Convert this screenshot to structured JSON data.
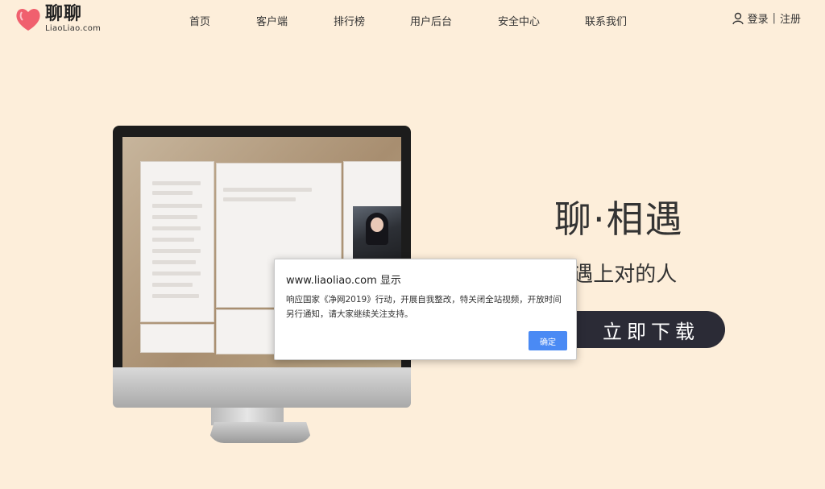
{
  "logo": {
    "name": "聊聊",
    "domain": "LiaoLiao.com"
  },
  "nav": {
    "items": [
      "首页",
      "客户端",
      "排行榜",
      "用户后台",
      "安全中心",
      "联系我们"
    ]
  },
  "account": {
    "login": "登录",
    "separator": "|",
    "register": "注册"
  },
  "hero": {
    "title": "聊·相遇",
    "subtitle": "申 在聊聊遇上对的人",
    "download_button": "立即下载"
  },
  "dialog": {
    "title": "www.liaoliao.com 显示",
    "message": "响应国家《净网2019》行动，开展自我整改，特关闭全站视频，开放时间另行通知，请大家继续关注支持。",
    "ok_button": "确定"
  },
  "colors": {
    "background": "#fdeeda",
    "accent": "#4a8af4",
    "button_dark": "#2b2b36",
    "logo_heart": "#f0606e"
  }
}
